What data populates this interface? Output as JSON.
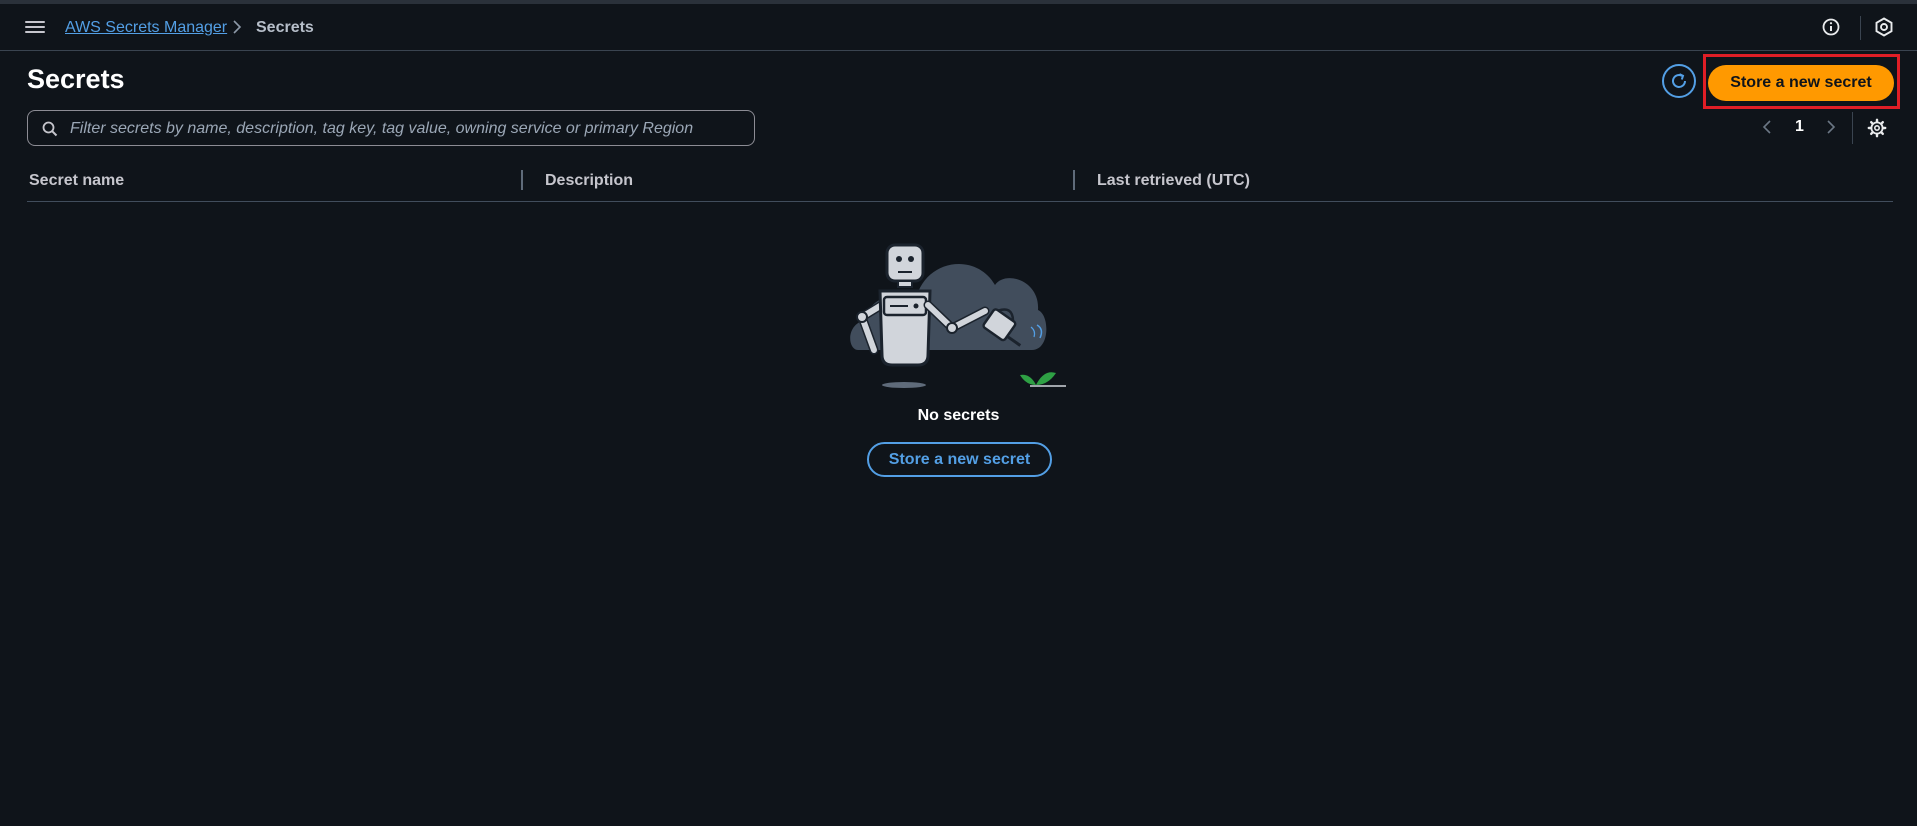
{
  "breadcrumb": {
    "service_link": "AWS Secrets Manager",
    "separator": ">",
    "current": "Secrets"
  },
  "header": {
    "title": "Secrets",
    "primary_button": "Store a new secret"
  },
  "filter": {
    "placeholder": "Filter secrets by name, description, tag key, tag value, owning service or primary Region",
    "value": ""
  },
  "pagination": {
    "current_page": "1"
  },
  "table": {
    "columns": [
      "Secret name",
      "Description",
      "Last retrieved (UTC)"
    ],
    "rows": []
  },
  "empty_state": {
    "title": "No secrets",
    "button": "Store a new secret"
  },
  "icons": {
    "menu": "hamburger-icon",
    "info": "info-icon",
    "settings": "settings-icon",
    "refresh": "refresh-icon",
    "search": "search-icon",
    "prev": "chevron-left-icon",
    "next": "chevron-right-icon",
    "preferences": "gear-icon"
  },
  "colors": {
    "background": "#0f141a",
    "link": "#539fe5",
    "primary": "#ff9900",
    "highlight": "#e01e26"
  }
}
